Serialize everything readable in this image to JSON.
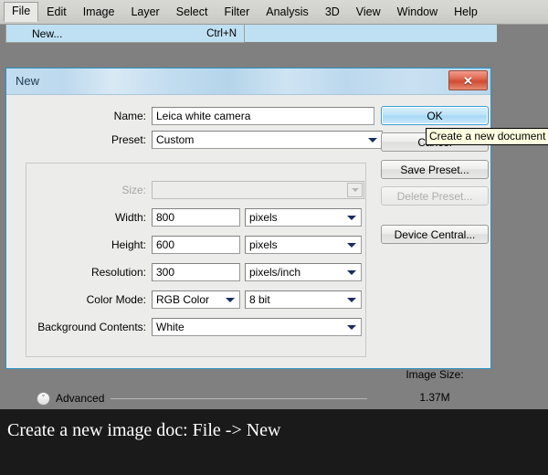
{
  "menubar": {
    "items": [
      {
        "label": "File",
        "active": true
      },
      {
        "label": "Edit",
        "active": false
      },
      {
        "label": "Image",
        "active": false
      },
      {
        "label": "Layer",
        "active": false
      },
      {
        "label": "Select",
        "active": false
      },
      {
        "label": "Filter",
        "active": false
      },
      {
        "label": "Analysis",
        "active": false
      },
      {
        "label": "3D",
        "active": false
      },
      {
        "label": "View",
        "active": false
      },
      {
        "label": "Window",
        "active": false
      },
      {
        "label": "Help",
        "active": false
      }
    ]
  },
  "file_menu": {
    "items": [
      {
        "label": "New...",
        "shortcut": "Ctrl+N",
        "highlighted": true
      }
    ]
  },
  "dialog": {
    "title": "New",
    "close_label": "✕",
    "fields": {
      "name_label": "Name:",
      "name_value": "Leica white camera",
      "preset_label": "Preset:",
      "preset_value": "Custom",
      "size_label": "Size:",
      "size_value": "",
      "width_label": "Width:",
      "width_value": "800",
      "width_unit": "pixels",
      "height_label": "Height:",
      "height_value": "600",
      "height_unit": "pixels",
      "resolution_label": "Resolution:",
      "resolution_value": "300",
      "resolution_unit": "pixels/inch",
      "color_mode_label": "Color Mode:",
      "color_mode_value": "RGB Color",
      "color_depth_value": "8 bit",
      "background_label": "Background Contents:",
      "background_value": "White"
    },
    "advanced": {
      "label": "Advanced",
      "toggle_glyph": "ˇ"
    },
    "buttons": [
      {
        "label": "OK",
        "style": "primary",
        "enabled": true
      },
      {
        "label": "Cancel",
        "style": "normal",
        "enabled": true
      },
      {
        "label": "Save Preset...",
        "style": "normal",
        "enabled": true
      },
      {
        "label": "Delete Preset...",
        "style": "normal",
        "enabled": false
      },
      {
        "label": "Device Central...",
        "style": "normal",
        "enabled": true
      }
    ],
    "image_size": {
      "label": "Image Size:",
      "value": "1.37M"
    }
  },
  "tooltip": {
    "text": "Create a new document"
  },
  "caption": {
    "text": "Create a new image doc: File -> New"
  },
  "colors": {
    "desktop": "#808080",
    "dialog_bg": "#ececeb",
    "dialog_border": "#2d93c4",
    "menu_highlight": "#bfe0f2",
    "tooltip_bg": "#ffffe1",
    "close_button": "#cf4b31",
    "caption_bg": "#1a1a1a"
  }
}
